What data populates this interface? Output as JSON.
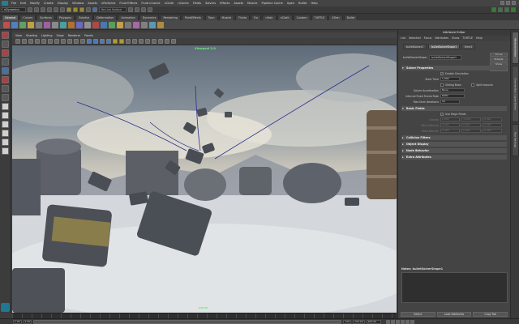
{
  "menubar": {
    "items": [
      "File",
      "Edit",
      "Modify",
      "Create",
      "Display",
      "Window",
      "Assets",
      "nParticles",
      "Fluid Effects",
      "Fluid nCache",
      "nCloth",
      "nCache",
      "Fields",
      "Solvers",
      "Effects",
      "Assets",
      "Muscle",
      "Pipeline Cache",
      "Xgen",
      "Bullet",
      "Help"
    ]
  },
  "statusline": {
    "mode": "nDynamics",
    "live_surface": "No Live Surface"
  },
  "shelf_tabs": {
    "items": [
      "General",
      "Curves",
      "Surfaces",
      "Polygons",
      "Subdivs",
      "Deformation",
      "Animation",
      "Dynamics",
      "Rendering",
      "PaintEffects",
      "Toon",
      "Muscle",
      "Fluids",
      "Fur",
      "nHair",
      "nCloth",
      "Custom",
      "TURTLE",
      "XGen",
      "Bullet"
    ],
    "active_index": 0
  },
  "viewport": {
    "menu": [
      "View",
      "Shading",
      "Lighting",
      "Show",
      "Renderer",
      "Panels"
    ],
    "top_label": "Viewport 2.0",
    "camera_label": "persp"
  },
  "attribute_editor": {
    "title": "Attribute Editor",
    "menu": [
      "List",
      "Selected",
      "Focus",
      "Attributes",
      "Show",
      "TURTLE",
      "Help"
    ],
    "node_tabs": [
      "bulletSolver1",
      "bulletSolverShape1",
      "time1"
    ],
    "node_label": "bulletSolverShape:",
    "node_name": "bulletSolverShape1",
    "buttons": {
      "focus": "Focus",
      "presets": "Presets",
      "show": "Show",
      "hide": "Hide"
    },
    "sections": {
      "solver_properties": {
        "title": "Solver Properties",
        "enable_simulation": "Enable Simulation",
        "start_time_label": "Start Time",
        "start_time": "1.000",
        "sliding_brain_label": "Sliding Brain",
        "split_impulse_label": "Split Impulse",
        "solver_accel_label": "Solver Acceleration",
        "solver_accel": "None",
        "internal_fixed_label": "Internal Fixed Frame Rate",
        "internal_fixed": "60Hz",
        "num_iterations_label": "Max Num Iterations",
        "num_iterations": "10"
      },
      "basic_fields": {
        "title": "Basic Fields",
        "use_attr_fields": "Use Maya Fields",
        "gravity_label": "Gravity",
        "gravity": [
          "0.000",
          "-9.810",
          "0.000"
        ],
        "wind_velocity_label": "Wind Velocity",
        "wind_velocity": [
          "0.000",
          "0.000",
          "0.000"
        ],
        "wind_density_label": "Wind Density",
        "wind_density": [
          "0.000",
          "0.000",
          "0.000"
        ]
      },
      "collapsed": [
        "Collision Filters",
        "Object Display",
        "Node Behavior",
        "Extra Attributes"
      ]
    },
    "notes_label": "Notes:  bulletSolverShape1",
    "bottom_buttons": [
      "Select",
      "Load Attributes",
      "Copy Tab"
    ]
  },
  "side_tabs": [
    "Attribute Editor",
    "Channel Box / Layer Editor",
    "Tool Settings"
  ],
  "range": {
    "start": "1.00",
    "start2": "1.00",
    "end": "120",
    "end2": "120.00",
    "current": "200.00"
  },
  "colors": {
    "viewport_label": "#6cf07a",
    "curve": "#2a2f8a",
    "accent": "#1f7890"
  }
}
